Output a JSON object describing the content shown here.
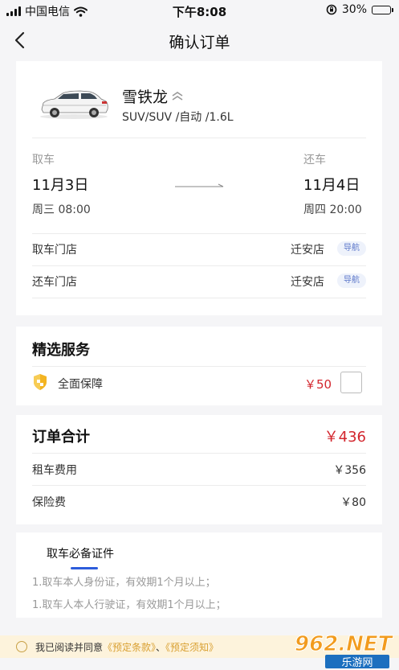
{
  "status": {
    "carrier": "中国电信",
    "time": "下午8:08",
    "battery_level": "30%"
  },
  "header": {
    "title": "确认订单"
  },
  "car": {
    "name": "雪铁龙",
    "spec": "SUV/SUV /自动 /1.6L"
  },
  "pickup": {
    "label": "取车",
    "date": "11月3日",
    "time": "周三 08:00"
  },
  "return": {
    "label": "还车",
    "date": "11月4日",
    "time": "周四 20:00"
  },
  "stores": [
    {
      "label": "取车门店",
      "value": "迁安店",
      "nav": "导航"
    },
    {
      "label": "还车门店",
      "value": "迁安店",
      "nav": "导航"
    }
  ],
  "services": {
    "title": "精选服务",
    "items": [
      {
        "name": "全面保障",
        "price": "￥50",
        "checked": false
      }
    ]
  },
  "order": {
    "title": "订单合计",
    "total": "￥436",
    "rows": [
      {
        "label": "租车费用",
        "value": "￥356"
      },
      {
        "label": "保险费",
        "value": "￥80"
      }
    ]
  },
  "documents": {
    "tab": "取车必备证件",
    "lines": [
      "1.取车本人身份证，有效期1个月以上；",
      "1.取车人本人行驶证，有效期1个月以上；"
    ]
  },
  "agreement": {
    "prefix": "我已阅读并同意",
    "link1": "《预定条款》",
    "sep": "、",
    "link2": "《预定须知》"
  },
  "watermark": {
    "brand": "962.NET",
    "sub": "乐游网"
  },
  "colors": {
    "price_red": "#d3262e",
    "nav_tag_blue": "#5b76c9",
    "link_gold": "#d9a032",
    "underline_blue": "#2d5ddb"
  }
}
